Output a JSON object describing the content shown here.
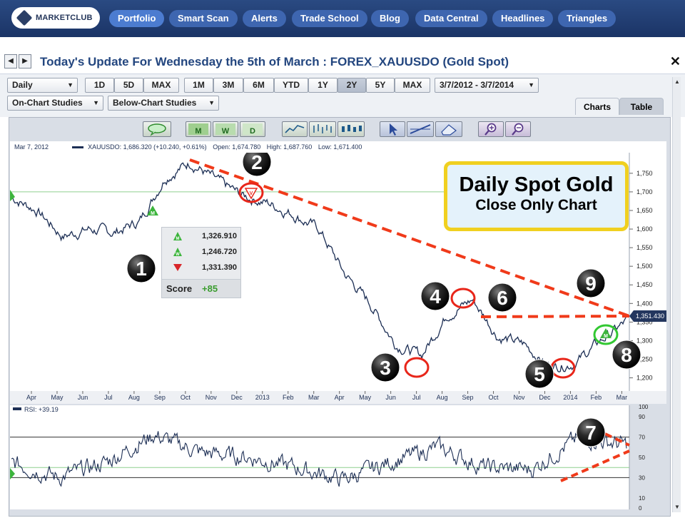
{
  "nav": {
    "logo_text": "MARKETCLUB",
    "items": [
      {
        "label": "Portfolio",
        "active": true
      },
      {
        "label": "Smart Scan"
      },
      {
        "label": "Alerts"
      },
      {
        "label": "Trade School"
      },
      {
        "label": "Blog"
      },
      {
        "label": "Data Central"
      },
      {
        "label": "Headlines"
      },
      {
        "label": "Triangles"
      }
    ]
  },
  "titlebar": {
    "prev_label": "◀",
    "next_label": "▶",
    "title": "Today's Update For Wednesday the 5th of March : FOREX_XAUUSDO (Gold Spot)",
    "close_label": "✕"
  },
  "toolbar": {
    "period_value": "Daily",
    "range_buttons": [
      "1D",
      "5D",
      "MAX",
      "1M",
      "3M",
      "6M",
      "YTD",
      "1Y",
      "2Y",
      "5Y",
      "MAX"
    ],
    "selected_range": "2Y",
    "date_range": "3/7/2012 - 3/7/2014",
    "on_chart_studies": "On-Chart Studies",
    "below_chart_studies": "Below-Chart Studies",
    "tabs": [
      {
        "label": "Charts",
        "active": true
      },
      {
        "label": "Table"
      }
    ]
  },
  "infobar": {
    "date": "Mar 7, 2012",
    "symbol_line": "XAUUSDO: 1,686.320 (+10.240, +0.61%)",
    "open": "Open: 1,6​74.780",
    "high": "High: 1,687.760",
    "low": "Low: 1,671.400"
  },
  "annotation": {
    "line1": "Daily Spot Gold",
    "line2": "Close Only Chart",
    "border_color": "#f0d020",
    "fill_color": "#e4f2fb"
  },
  "score_box": {
    "rows": [
      {
        "icon": "m-up-arrow-icon",
        "value": "1,326.910"
      },
      {
        "icon": "w-up-arrow-icon",
        "value": "1,246.720"
      },
      {
        "icon": "down-arrow-icon",
        "value": "1,331.390"
      }
    ],
    "score_label": "Score",
    "score_value": "+85",
    "score_color": "#3a9c2e"
  },
  "last_price": "1,351.430",
  "rsi_label": "RSI: +39.19",
  "markers": [
    "1",
    "2",
    "3",
    "4",
    "5",
    "6",
    "7",
    "8",
    "9"
  ],
  "colors": {
    "nav_bg": "#1f3a72",
    "price_line": "#1d2f55",
    "trend_dash": "#f03a1a",
    "circle_red": "#e8261a",
    "circle_green": "#32c832",
    "signal_green": "#3cb43c"
  },
  "chart_data": [
    {
      "type": "line",
      "title": "",
      "series": [
        {
          "name": "XAUUSDO",
          "x": [
            "2012-03",
            "2012-04",
            "2012-05",
            "2012-06",
            "2012-07",
            "2012-08",
            "2012-09",
            "2012-10",
            "2012-11",
            "2012-12",
            "2013-01",
            "2013-02",
            "2013-03",
            "2013-04",
            "2013-05",
            "2013-06",
            "2013-07",
            "2013-08",
            "2013-09",
            "2013-10",
            "2013-11",
            "2013-12",
            "2014-01",
            "2014-02",
            "2014-03"
          ],
          "y": [
            1686,
            1650,
            1580,
            1600,
            1590,
            1620,
            1740,
            1780,
            1730,
            1690,
            1670,
            1640,
            1600,
            1480,
            1400,
            1290,
            1260,
            1370,
            1410,
            1310,
            1290,
            1230,
            1240,
            1300,
            1351
          ]
        }
      ],
      "x_tick_labels": [
        "Apr",
        "May",
        "Jun",
        "Jul",
        "Aug",
        "Sep",
        "Oct",
        "Nov",
        "Dec",
        "2013",
        "Feb",
        "Mar",
        "Apr",
        "May",
        "Jun",
        "Jul",
        "Aug",
        "Sep",
        "Oct",
        "Nov",
        "Dec",
        "2014",
        "Feb",
        "Mar"
      ],
      "y_ticks": [
        1200,
        1250,
        1300,
        1350,
        1400,
        1450,
        1500,
        1550,
        1600,
        1650,
        1700,
        1750
      ],
      "y_tick_labels": [
        "1,200",
        "1,250",
        "1,300",
        "1,350",
        "1,400",
        "1,450",
        "1,500",
        "1,550",
        "1,600",
        "1,650",
        "1,700",
        "1,750"
      ],
      "ylim": [
        1180,
        1790
      ],
      "grid": false,
      "reference_line": 1700
    },
    {
      "type": "line",
      "series": [
        {
          "name": "RSI",
          "x": [
            "2012-03",
            "2012-05",
            "2012-07",
            "2012-09",
            "2012-11",
            "2013-01",
            "2013-03",
            "2013-05",
            "2013-07",
            "2013-09",
            "2013-11",
            "2014-01",
            "2014-02",
            "2014-03"
          ],
          "y": [
            45,
            30,
            45,
            72,
            55,
            50,
            40,
            28,
            45,
            60,
            40,
            38,
            70,
            62
          ]
        }
      ],
      "y_ticks": [
        0,
        10,
        30,
        50,
        70,
        90,
        100
      ],
      "ylim": [
        0,
        100
      ],
      "reference_lines": [
        30,
        40,
        70
      ]
    }
  ]
}
